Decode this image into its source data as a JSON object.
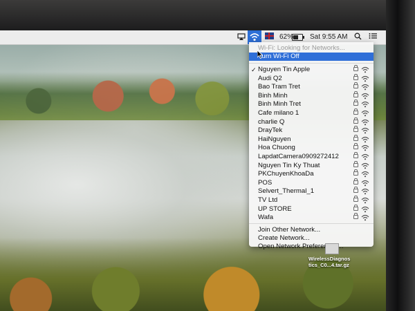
{
  "menubar": {
    "battery_percent": "62%",
    "battery_level": 0.62,
    "clock": "Sat 9:55 AM"
  },
  "wifi_menu": {
    "status": "Wi-Fi: Looking for Networks...",
    "toggle": "Turn Wi-Fi Off",
    "networks": [
      {
        "name": "Nguyen Tin Apple",
        "connected": true
      },
      {
        "name": "Audi Q2"
      },
      {
        "name": "Bao Tram Tret"
      },
      {
        "name": "Binh Minh"
      },
      {
        "name": "Binh Minh Tret"
      },
      {
        "name": "Cafe milano 1"
      },
      {
        "name": "charlie Q"
      },
      {
        "name": "DrayTek"
      },
      {
        "name": "HaiNguyen"
      },
      {
        "name": "Hoa Chuong"
      },
      {
        "name": "LapdatCamera0909272412"
      },
      {
        "name": "Nguyen Tin Ky Thuat"
      },
      {
        "name": "PKChuyenKhoaDa"
      },
      {
        "name": "POS"
      },
      {
        "name": "Selvert_Thermal_1"
      },
      {
        "name": "TV Ltd"
      },
      {
        "name": "UP STORE"
      },
      {
        "name": "Wafa"
      }
    ],
    "actions": [
      "Join Other Network...",
      "Create Network...",
      "Open Network Preferences..."
    ]
  },
  "desktop": {
    "file_name_line1": "WirelessDiagnos",
    "file_name_line2": "tics_C0...4.tar.gz"
  },
  "colors": {
    "highlight": "#2f6fd8",
    "menubar": "#ececec"
  }
}
